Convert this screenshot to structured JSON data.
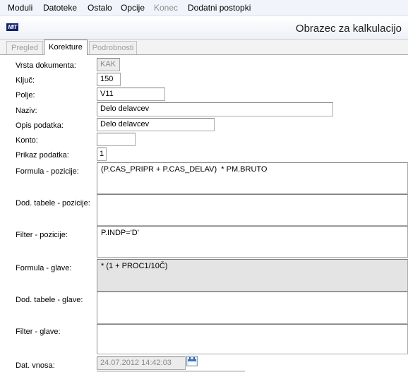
{
  "menu": {
    "items": [
      {
        "label": "Moduli",
        "enabled": true
      },
      {
        "label": "Datoteke",
        "enabled": true
      },
      {
        "label": "Ostalo",
        "enabled": true
      },
      {
        "label": "Opcije",
        "enabled": true
      },
      {
        "label": "Konec",
        "enabled": false
      },
      {
        "label": "Dodatni postopki",
        "enabled": true
      }
    ]
  },
  "window": {
    "logo_text": "MIT",
    "title": "Obrazec za kalkulacijo"
  },
  "tabs": [
    {
      "label": "Pregled",
      "active": false
    },
    {
      "label": "Korekture",
      "active": true
    },
    {
      "label": "Podrobnosti",
      "active": false
    }
  ],
  "form": {
    "vrsta_dokumenta": {
      "label": "Vrsta dokumenta:",
      "value": "KAK"
    },
    "kljuc": {
      "label": "Ključ:",
      "value": "150"
    },
    "polje": {
      "label": "Polje:",
      "value": "V11"
    },
    "naziv": {
      "label": "Naziv:",
      "value": "Delo delavcev"
    },
    "opis_podatka": {
      "label": "Opis podatka:",
      "value": "Delo delavcev"
    },
    "konto": {
      "label": "Konto:",
      "value": ""
    },
    "prikaz_podatka": {
      "label": "Prikaz podatka:",
      "value": "1"
    },
    "formula_pozicije": {
      "label": "Formula - pozicije:",
      "value": "(P.CAS_PRIPR + P.CAS_DELAV)  * PM.BRUTO"
    },
    "dod_tabele_pozicije": {
      "label": "Dod. tabele - pozicije:",
      "value": ""
    },
    "filter_pozicije": {
      "label": "Filter - pozicije:",
      "value": "P.INDP='D'"
    },
    "formula_glave": {
      "label": "Formula - glave:",
      "value": "* (1 + PROC1/10Č)"
    },
    "dod_tabele_glave": {
      "label": "Dod. tabele - glave:",
      "value": ""
    },
    "filter_glave": {
      "label": "Filter - glave:",
      "value": ""
    },
    "dat_vnosa": {
      "label": "Dat. vnosa:",
      "value": "24.07.2012 14:42:03"
    }
  },
  "icons": {
    "logo": "mit-logo",
    "calendar": "calendar-icon"
  },
  "colors": {
    "menubar_bg": "#f1f5fb",
    "logo_bg": "#12236a",
    "readonly_bg": "#ececec",
    "shaded_area_bg": "#e4e4e4"
  }
}
